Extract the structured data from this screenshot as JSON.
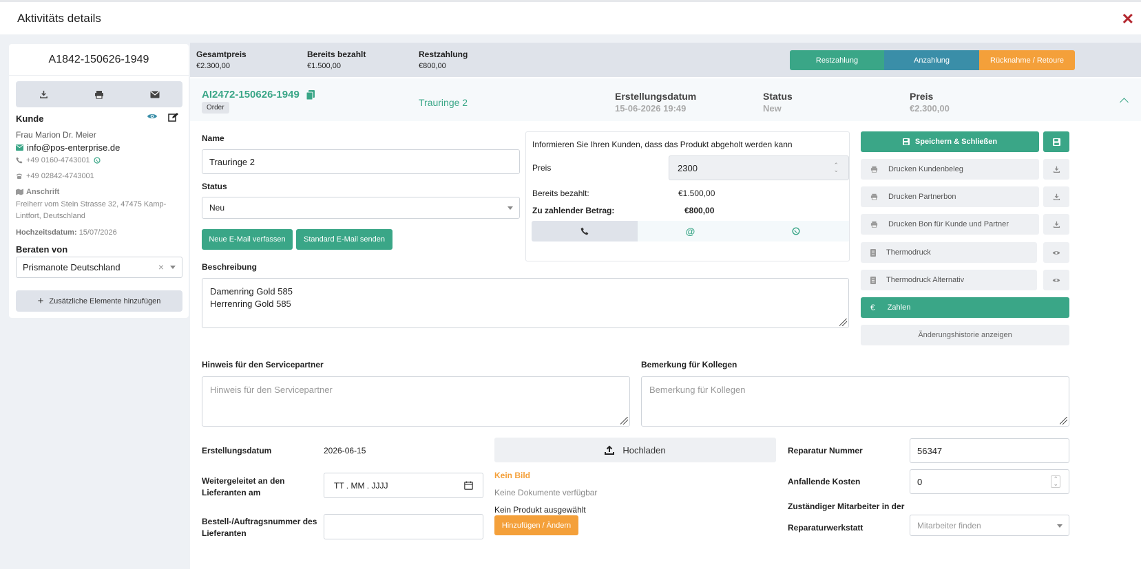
{
  "window": {
    "title": "Aktivitäts details",
    "close": "✕"
  },
  "left": {
    "reference": "A1842-150626-1949",
    "kunde_label": "Kunde",
    "customer_name": "Frau Marion Dr. Meier",
    "email": "info@pos-enterprise.de",
    "phone1": "+49 0160-4743001",
    "phone2": "+49 02842-4743001",
    "anschrift_label": "Anschrift",
    "address": "Freiherr vom Stein Strasse 32, 47475 Kamp-Lintfort, Deutschland",
    "hochzeit_label": "Hochzeitsdatum:",
    "hochzeit_value": "15/07/2026",
    "beraten_label": "Beraten von",
    "beraten_value": "Prismanote Deutschland",
    "add_elements": "Zusätzliche Elemente hinzufügen"
  },
  "summary": {
    "gesamt_label": "Gesamtpreis",
    "gesamt_value": "€2.300,00",
    "bezahlt_label": "Bereits bezahlt",
    "bezahlt_value": "€1.500,00",
    "rest_label": "Restzahlung",
    "rest_value": "€800,00",
    "btn_rest": "Restzahlung",
    "btn_anzahlung": "Anzahlung",
    "btn_retoure": "Rücknahme / Retoure"
  },
  "order": {
    "id": "AI2472-150626-1949",
    "badge": "Order",
    "product": "Trauringe 2",
    "erstellung_label": "Erstellungsdatum",
    "erstellung_value": "15-06-2026 19:49",
    "status_label": "Status",
    "status_value": "New",
    "preis_label": "Preis",
    "preis_value": "€2.300,00"
  },
  "form": {
    "name_label": "Name",
    "name_value": "Trauringe 2",
    "status_label": "Status",
    "status_value": "Neu",
    "btn_neue_email": "Neue E-Mail verfassen",
    "btn_standard_email": "Standard E-Mail senden",
    "beschreibung_label": "Beschreibung",
    "beschreibung_line1": "Damenring Gold 585",
    "beschreibung_line2": "Herrenring Gold 585",
    "hinweis_label": "Hinweis für den Servicepartner",
    "hinweis_placeholder": "Hinweis für den Servicepartner",
    "bemerkung_label": "Bemerkung für Kollegen",
    "bemerkung_placeholder": "Bemerkung für Kollegen",
    "erstellung_label": "Erstellungsdatum",
    "erstellung_value": "2026-06-15",
    "weiter_label_1": "Weitergeleitet an den",
    "weiter_label_2": "Lieferanten am",
    "weiter_placeholder": "TT . MM . JJJJ",
    "bestell_label_1": "Bestell-/Auftragsnummer des",
    "bestell_label_2": "Lieferanten",
    "upload": "Hochladen",
    "kein_bild": "Kein Bild",
    "keine_dokumente": "Keine Dokumente verfügbar",
    "kein_produkt": "Kein Produkt ausgewählt",
    "btn_hinzufuegen": "Hinzufügen / Ändern",
    "reparatur_label": "Reparatur Nummer",
    "reparatur_value": "56347",
    "kosten_label": "Anfallende Kosten",
    "kosten_value": "0",
    "mitarbeiter_label_1": "Zuständiger Mitarbeiter in der",
    "mitarbeiter_label_2": "Reparaturwerkstatt",
    "mitarbeiter_placeholder": "Mitarbeiter finden"
  },
  "info": {
    "text": "Informieren Sie Ihren Kunden, dass das Produkt abgeholt werden kann",
    "preis_label": "Preis",
    "preis_value": "2300",
    "bezahlt_label": "Bereits bezahlt:",
    "bezahlt_value": "€1.500,00",
    "zahlender_label": "Zu zahlender Betrag:",
    "zahlender_value": "€800,00"
  },
  "actions": {
    "save": "Speichern & Schließen",
    "druck_kunde": "Drucken Kundenbeleg",
    "druck_partner": "Drucken Partnerbon",
    "druck_beide": "Drucken Bon für Kunde und Partner",
    "thermo": "Thermodruck",
    "thermo_alt": "Thermodruck Alternativ",
    "zahlen": "Zahlen",
    "historie": "Änderungshistorie anzeigen"
  },
  "colors": {
    "green": "#3aa687",
    "blue": "#3a8ea8",
    "orange": "#f4a03a",
    "close_red": "#b3262e"
  }
}
